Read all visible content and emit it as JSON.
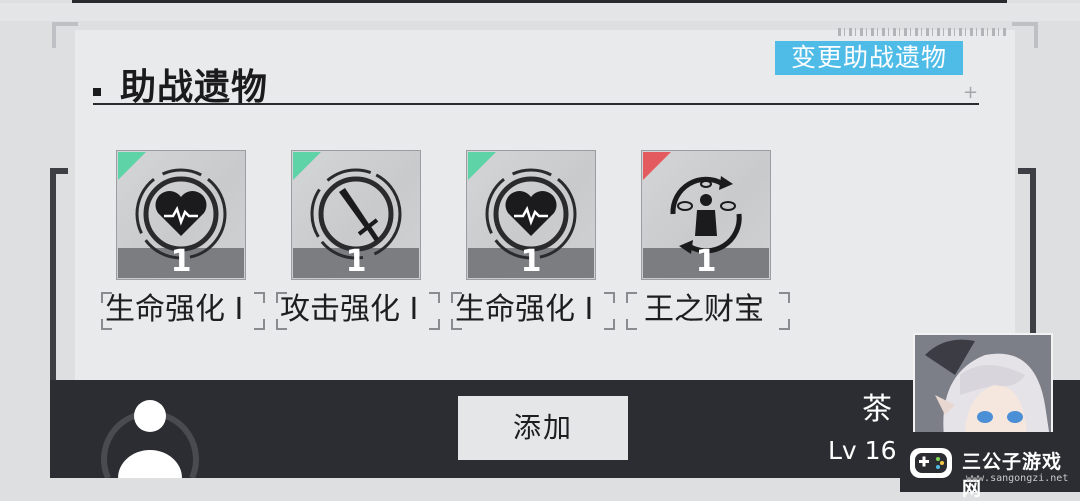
{
  "section": {
    "title": "助战遗物",
    "change_button": "变更助战遗物"
  },
  "relics": [
    {
      "name": "生命强化",
      "suffix": "Ⅰ",
      "level": "1",
      "icon": "heart-pulse-icon",
      "rarity_color": "#5fd3a8"
    },
    {
      "name": "攻击强化",
      "suffix": "Ⅰ",
      "level": "1",
      "icon": "sword-icon",
      "rarity_color": "#5fd3a8"
    },
    {
      "name": "生命强化",
      "suffix": "Ⅰ",
      "level": "1",
      "icon": "heart-pulse-icon",
      "rarity_color": "#5fd3a8"
    },
    {
      "name": "王之财宝",
      "suffix": "",
      "level": "1",
      "icon": "juggling-coins-icon",
      "rarity_color": "#e35a5f"
    }
  ],
  "player": {
    "name": "茶",
    "level": "Lv 16",
    "add_button": "添加"
  },
  "watermark": {
    "title": "三公子游戏网",
    "url": "www.sangongzi.net"
  },
  "colors": {
    "accent": "#4fbce8",
    "dark_bar": "#2c2d32",
    "rarity_green": "#5fd3a8",
    "rarity_red": "#e35a5f"
  }
}
